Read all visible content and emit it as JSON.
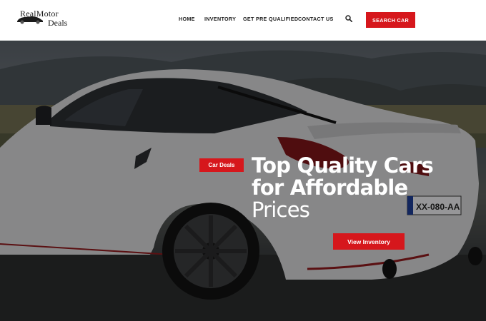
{
  "brand": {
    "logo_line1": "RealMotor",
    "logo_line2": "Deals"
  },
  "nav": {
    "items": [
      {
        "label": "HOME"
      },
      {
        "label": "INVENTORY"
      },
      {
        "label": "GET PRE QUALIFIED"
      },
      {
        "label": "CONTACT US"
      }
    ]
  },
  "header": {
    "search_icon": "search-icon",
    "search_button": "SEARCH CAR"
  },
  "hero": {
    "badge": "Car Deals",
    "headline_line1": "Top Quality Cars",
    "headline_line2": "for Affordable",
    "headline_line3": "Prices",
    "cta": "View Inventory",
    "plate": "XX-080-AA"
  },
  "colors": {
    "accent": "#d6171c",
    "header_bg": "#ffffff",
    "nav_text": "#222222"
  }
}
